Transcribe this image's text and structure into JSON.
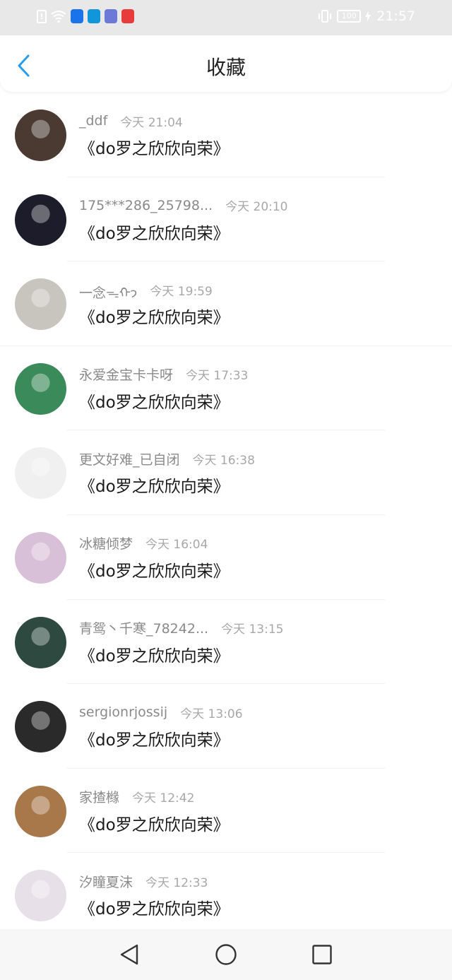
{
  "status_bar": {
    "time": "21:57",
    "battery": "100",
    "icons": [
      "warning-icon",
      "wifi-icon",
      "app-icon",
      "search-app-icon",
      "music-app-icon",
      "huawei-app-icon"
    ]
  },
  "header": {
    "title": "收藏",
    "back_icon": "chevron-left-icon"
  },
  "favorites": [
    {
      "username": "_ddf",
      "time": "今天 21:04",
      "content": "《do罗之欣欣向荣》",
      "avatar_color": "#4a3a32"
    },
    {
      "username": "175***286_25798...",
      "time": "今天 20:10",
      "content": "《do罗之欣欣向荣》",
      "avatar_color": "#1c1c2a"
    },
    {
      "username": "一念ᯓᡣ𐭩",
      "time": "今天 19:59",
      "content": "《do罗之欣欣向荣》",
      "avatar_color": "#c8c4be"
    },
    {
      "username": "永爱金宝卡卡呀",
      "time": "今天 17:33",
      "content": "《do罗之欣欣向荣》",
      "avatar_color": "#3a8a5a"
    },
    {
      "username": "更文好难_已自闭",
      "time": "今天 16:38",
      "content": "《do罗之欣欣向荣》",
      "avatar_color": "#f0f0f0"
    },
    {
      "username": "冰糖倾梦",
      "time": "今天 16:04",
      "content": "《do罗之欣欣向荣》",
      "avatar_color": "#d8c0d8"
    },
    {
      "username": "青鸳丶千寒_78242...",
      "time": "今天 13:15",
      "content": "《do罗之欣欣向荣》",
      "avatar_color": "#2e4a40"
    },
    {
      "username": "sergionrjossij",
      "time": "今天 13:06",
      "content": "《do罗之欣欣向荣》",
      "avatar_color": "#2a2a2a"
    },
    {
      "username": "家揸橼",
      "time": "今天 12:42",
      "content": "《do罗之欣欣向荣》",
      "avatar_color": "#a8784a"
    },
    {
      "username": "汐瞳夏沫",
      "time": "今天 12:33",
      "content": "《do罗之欣欣向荣》",
      "avatar_color": "#e8e0e8"
    }
  ],
  "nav_bar": {
    "buttons": [
      "nav-back-icon",
      "nav-home-icon",
      "nav-recent-icon"
    ]
  },
  "colors": {
    "accent": "#2a9cf0",
    "status_bar_bg": "#e8e8e8",
    "username": "#8a8a8a",
    "time": "#a8a8a8",
    "content": "#1a1a1a"
  }
}
